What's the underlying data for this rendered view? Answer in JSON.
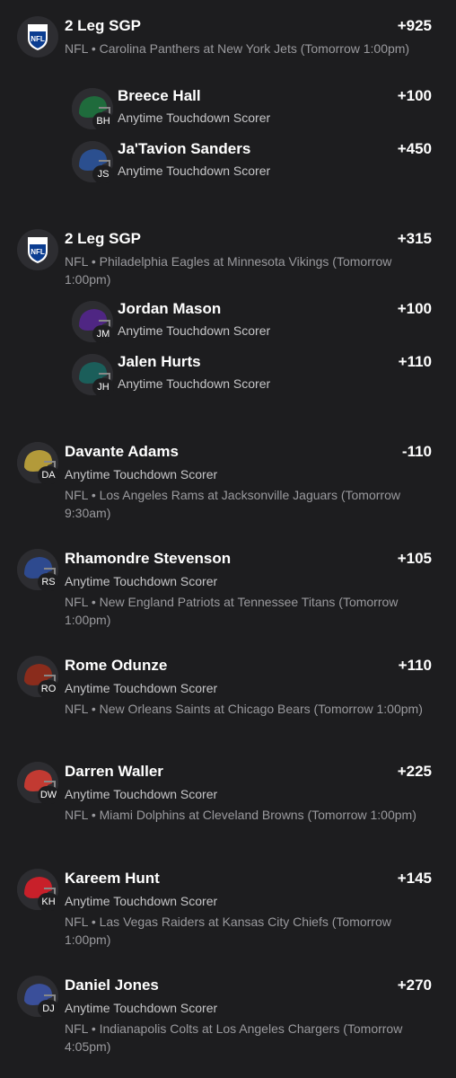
{
  "bets": [
    {
      "title": "2 Leg SGP",
      "odds": "+925",
      "league_icon": "nfl-shield-icon",
      "desc": "NFL • Carolina Panthers at New York Jets (Tomorrow 1:00pm)",
      "legs": [
        {
          "name": "Breece Hall",
          "odds": "+100",
          "market": "Anytime Touchdown Scorer",
          "initials": "BH",
          "color": "#1f6b3c"
        },
        {
          "name": "Ja'Tavion Sanders",
          "odds": "+450",
          "market": "Anytime Touchdown Scorer",
          "initials": "JS",
          "color": "#2b4f8f"
        }
      ]
    },
    {
      "title": "2 Leg SGP",
      "odds": "+315",
      "league_icon": "nfl-shield-icon",
      "desc": "NFL • Philadelphia Eagles at Minnesota Vikings (Tomorrow 1:00pm)",
      "legs": [
        {
          "name": "Jordan Mason",
          "odds": "+100",
          "market": "Anytime Touchdown Scorer",
          "initials": "JM",
          "color": "#4f2683"
        },
        {
          "name": "Jalen Hurts",
          "odds": "+110",
          "market": "Anytime Touchdown Scorer",
          "initials": "JH",
          "color": "#1b5e5a"
        }
      ]
    }
  ],
  "singles": [
    {
      "name": "Davante Adams",
      "odds": "-110",
      "market": "Anytime Touchdown Scorer",
      "initials": "DA",
      "color": "#b39a3a",
      "desc": "NFL • Los Angeles Rams at Jacksonville Jaguars (Tomorrow 9:30am)"
    },
    {
      "name": "Rhamondre Stevenson",
      "odds": "+105",
      "market": "Anytime Touchdown Scorer",
      "initials": "RS",
      "color": "#2e4a8f",
      "desc": "NFL • New England Patriots at Tennessee Titans (Tomorrow 1:00pm)"
    },
    {
      "name": "Rome Odunze",
      "odds": "+110",
      "market": "Anytime Touchdown Scorer",
      "initials": "RO",
      "color": "#8a2c1c",
      "desc": "NFL • New Orleans Saints at Chicago Bears (Tomorrow 1:00pm)"
    },
    {
      "name": "Darren Waller",
      "odds": "+225",
      "market": "Anytime Touchdown Scorer",
      "initials": "DW",
      "color": "#c23a32",
      "desc": "NFL • Miami Dolphins at Cleveland Browns (Tomorrow 1:00pm)"
    },
    {
      "name": "Kareem Hunt",
      "odds": "+145",
      "market": "Anytime Touchdown Scorer",
      "initials": "KH",
      "color": "#c8202a",
      "desc": "NFL • Las Vegas Raiders at Kansas City Chiefs (Tomorrow 1:00pm)"
    },
    {
      "name": "Daniel Jones",
      "odds": "+270",
      "market": "Anytime Touchdown Scorer",
      "initials": "DJ",
      "color": "#3a4f9a",
      "desc": "NFL • Indianapolis Colts at Los Angeles Chargers (Tomorrow 4:05pm)"
    }
  ]
}
